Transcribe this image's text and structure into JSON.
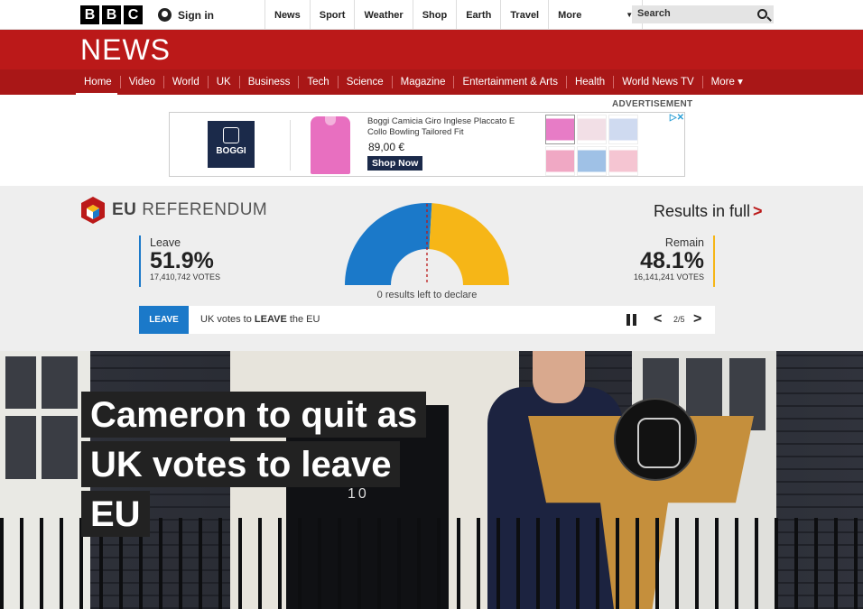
{
  "topbar": {
    "logo_letters": [
      "B",
      "B",
      "C"
    ],
    "sign_in": "Sign in",
    "nav": [
      "News",
      "Sport",
      "Weather",
      "Shop",
      "Earth",
      "Travel"
    ],
    "more": "More",
    "search_placeholder": "Search"
  },
  "news": {
    "title": "NEWS",
    "nav": [
      "Home",
      "Video",
      "World",
      "UK",
      "Business",
      "Tech",
      "Science",
      "Magazine",
      "Entertainment & Arts",
      "Health",
      "World News TV",
      "More ▾"
    ]
  },
  "ad": {
    "label": "ADVERTISEMENT",
    "brand": "BOGGI",
    "product": "Boggi Camicia Giro Inglese Placcato E Collo Bowling Tailored Fit",
    "price": "89,00 €",
    "cta": "Shop Now",
    "thumb_colors": [
      "#e77cc6",
      "#f2dfe6",
      "#cfdaf0",
      "#f0a8c4",
      "#9fc1e6",
      "#f5c5d2"
    ]
  },
  "eu": {
    "brand_prefix": "EU",
    "brand_suffix": "REFERENDUM",
    "results_link": "Results in full",
    "leave": {
      "label": "Leave",
      "percent": "51.9%",
      "votes": "17,410,742 VOTES",
      "share": 0.519,
      "color": "#1b79c9"
    },
    "remain": {
      "label": "Remain",
      "percent": "48.1%",
      "votes": "16,141,241 VOTES",
      "share": 0.481,
      "color": "#f6b617"
    },
    "declare": "0 results left to declare",
    "ticker": {
      "tag": "LEAVE",
      "msg_pre": "UK votes to ",
      "msg_bold": "LEAVE",
      "msg_post": " the EU",
      "count": "2/5"
    }
  },
  "hero": {
    "headline_lines": [
      "Cameron to quit as",
      "UK votes to leave",
      "EU"
    ],
    "door_number": "10"
  }
}
